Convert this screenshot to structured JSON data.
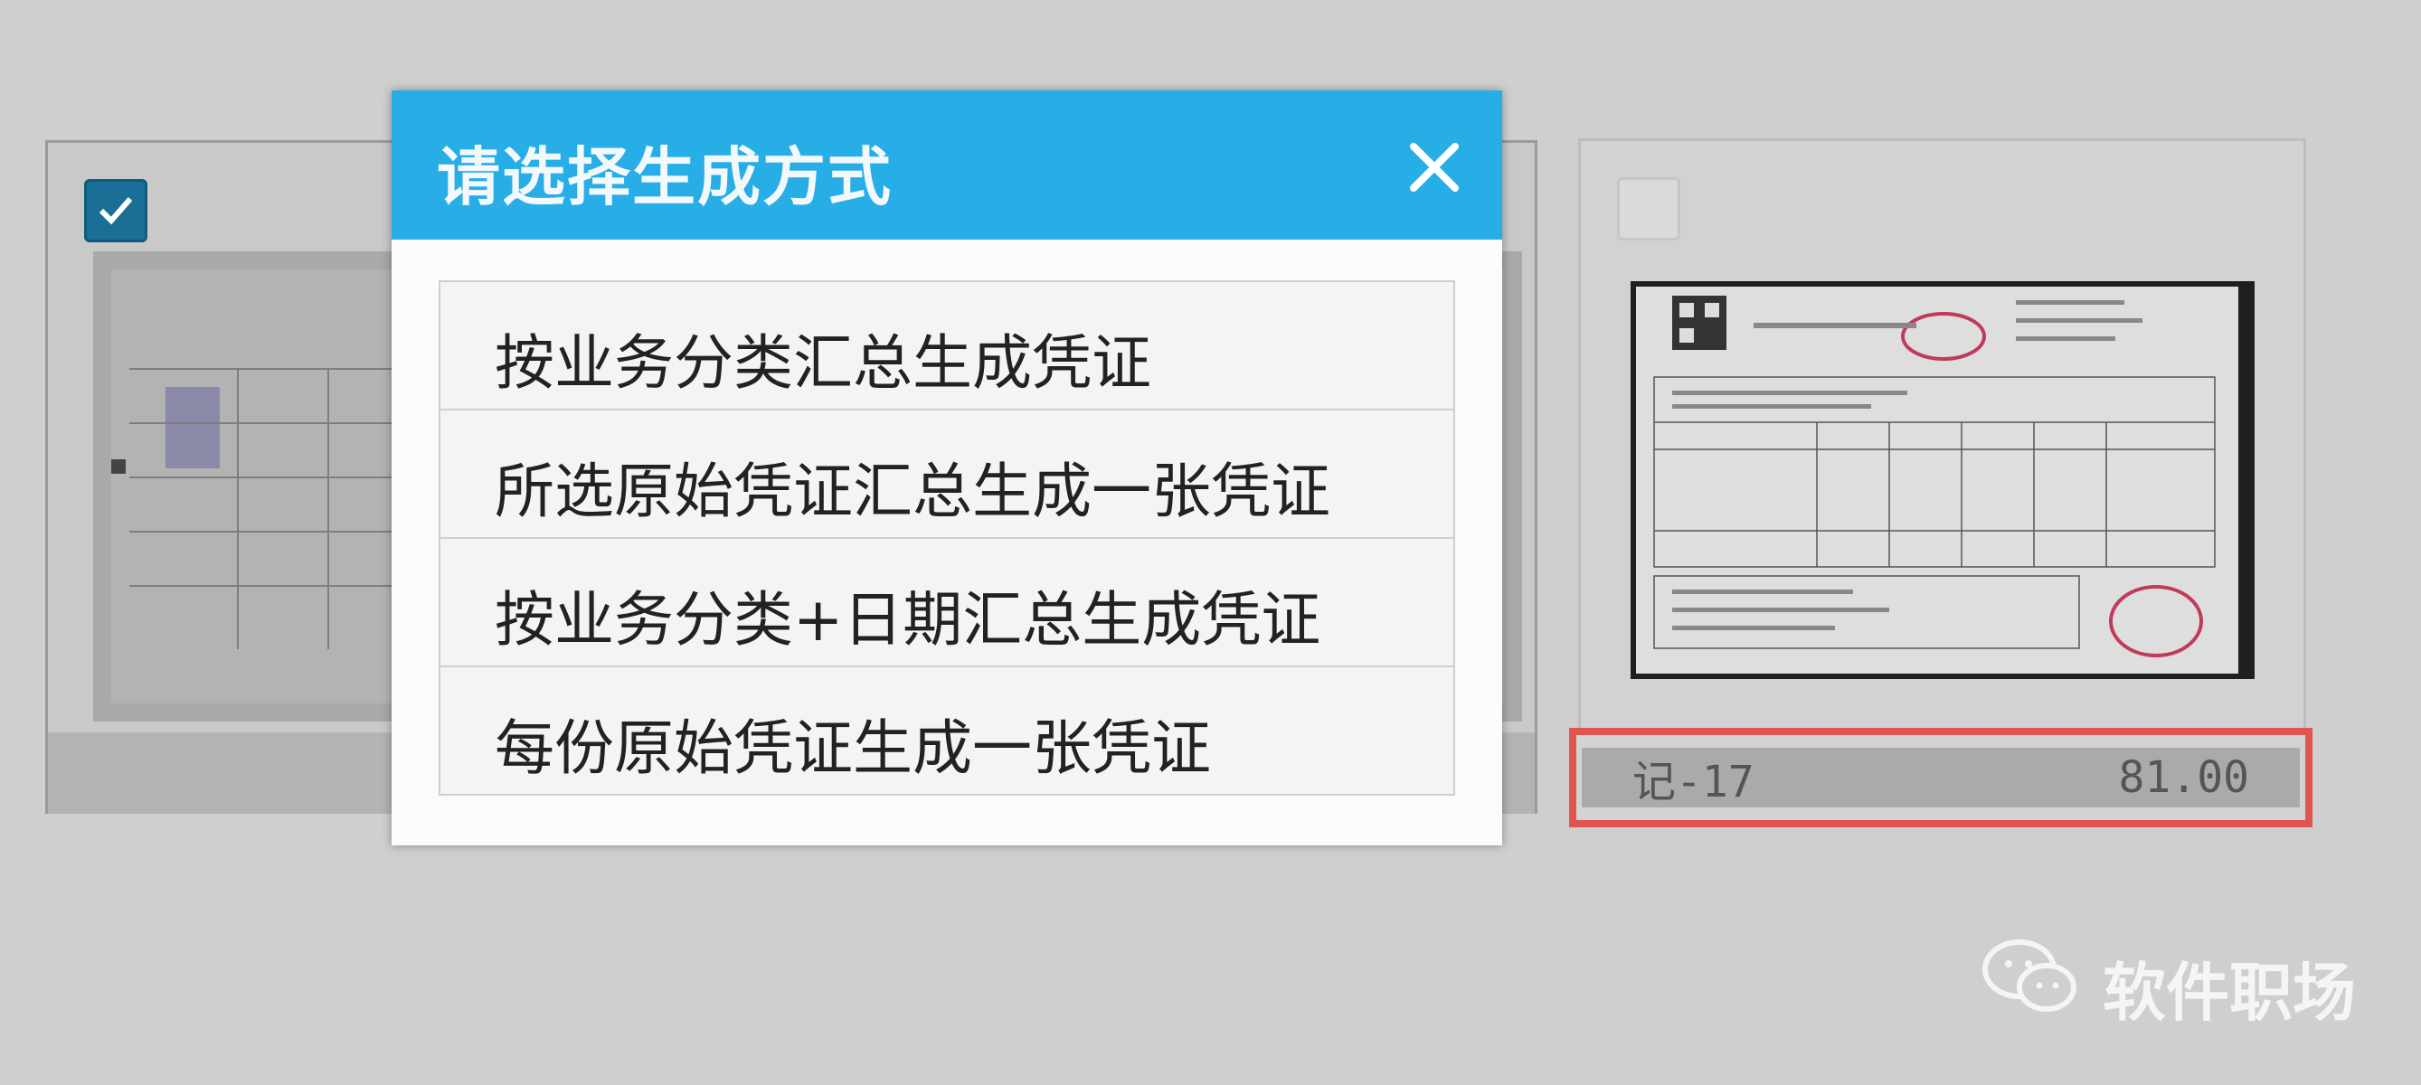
{
  "dialog": {
    "title": "请选择生成方式",
    "close_icon": "close-icon",
    "options": [
      {
        "label": "按业务分类汇总生成凭证"
      },
      {
        "label": "所选原始凭证汇总生成一张凭证"
      },
      {
        "label": "按业务分类+日期汇总生成凭证"
      },
      {
        "label": "每份原始凭证生成一张凭证"
      }
    ]
  },
  "cards": {
    "left": {
      "checked": true
    },
    "right": {
      "checked": false,
      "voucher_no": "记-17",
      "amount": "81.00"
    }
  },
  "watermark": {
    "icon": "wechat-icon",
    "text": "软件职场"
  },
  "colors": {
    "header": "#27aee6",
    "highlight": "#e0554f",
    "checkbox": "#1a6f97"
  }
}
